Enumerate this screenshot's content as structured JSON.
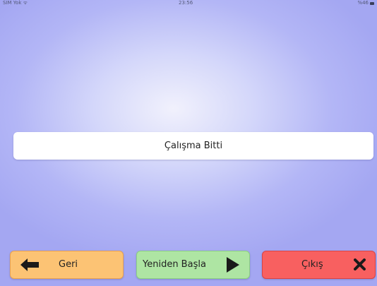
{
  "status_bar": {
    "carrier": "SIM Yok ᯤ",
    "time": "23:56",
    "battery": "%46"
  },
  "message": {
    "text": "Çalışma Bitti"
  },
  "buttons": {
    "back_label": "Geri",
    "restart_label": "Yeniden Başla",
    "exit_label": "Çıkış"
  },
  "icons": {
    "back": "arrow-left-icon",
    "restart": "play-icon",
    "exit": "close-icon"
  },
  "colors": {
    "back_button": "#fcc374",
    "restart_button": "#aee5a3",
    "exit_button": "#f86060"
  }
}
